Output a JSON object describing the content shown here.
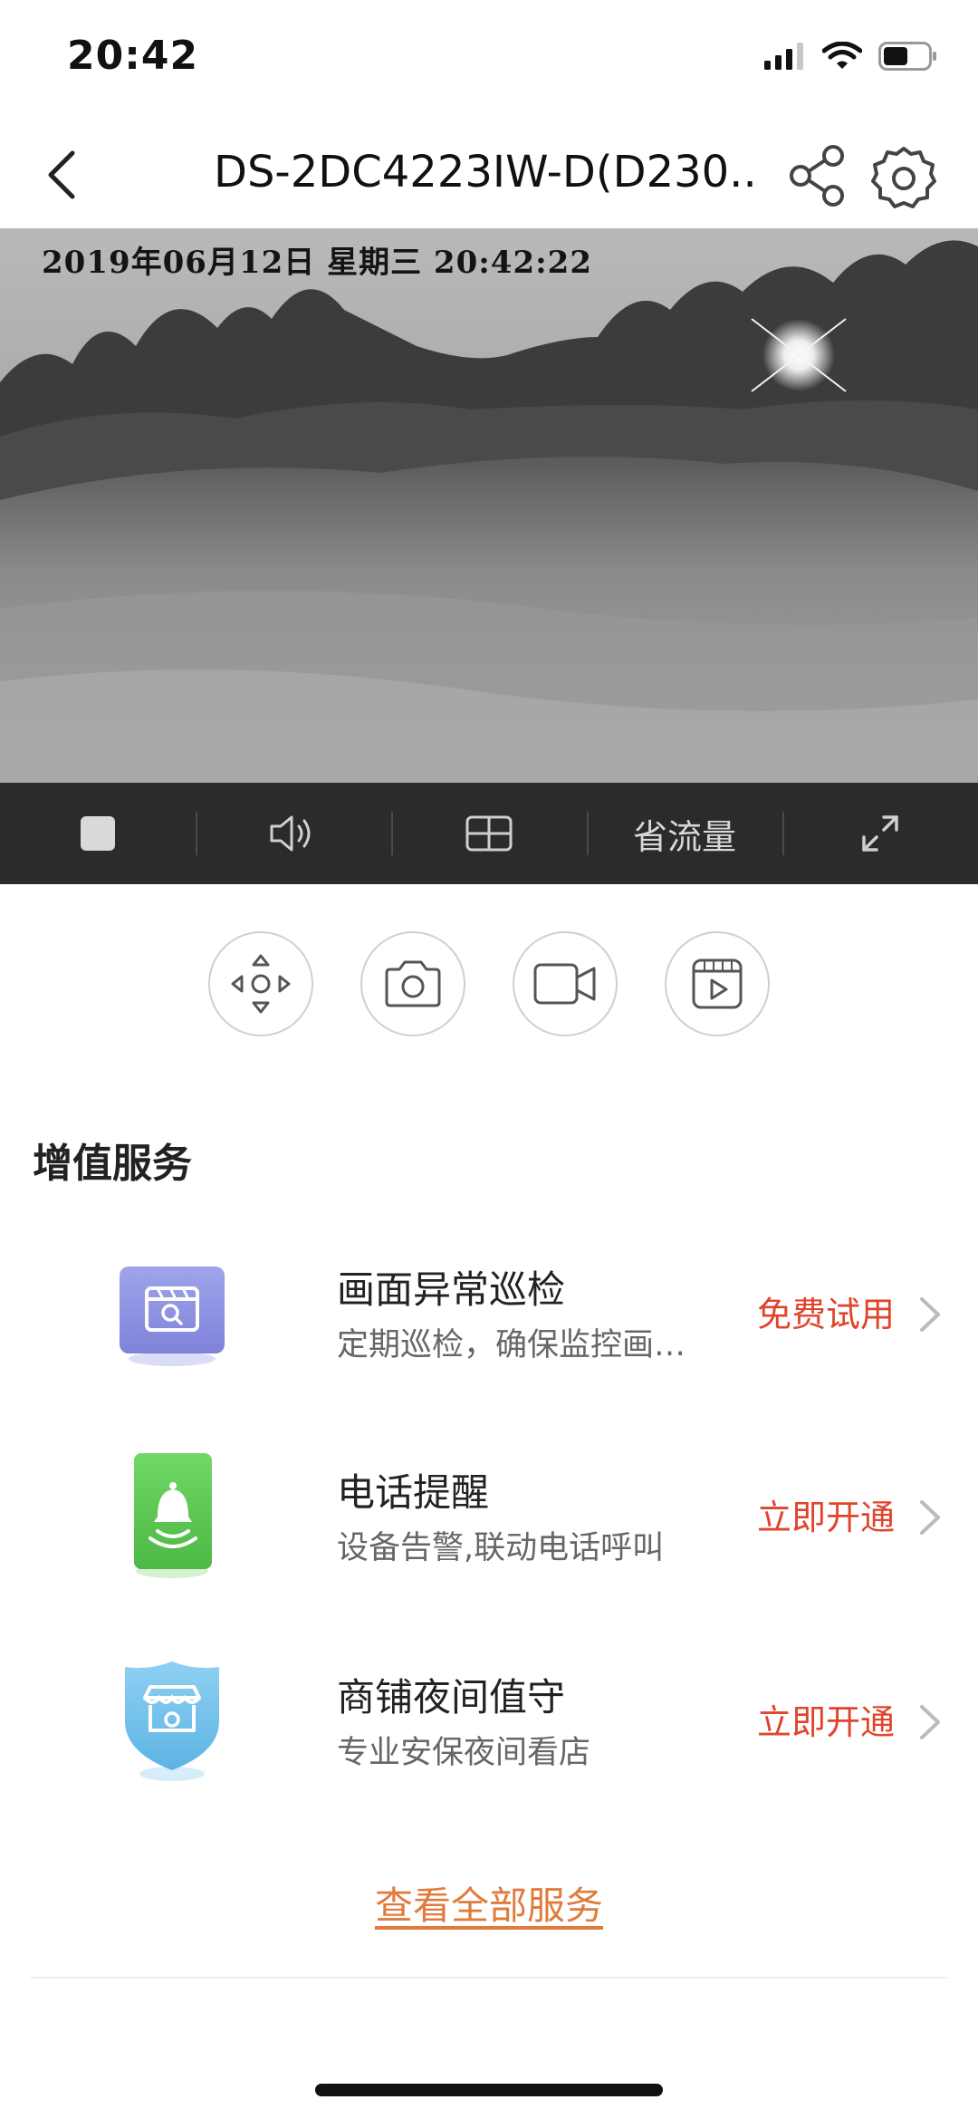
{
  "status_bar": {
    "time": "20:42",
    "icons": [
      "signal-icon",
      "wifi-icon",
      "battery-icon"
    ]
  },
  "nav": {
    "title": "DS-2DC4223IW-D(D230...",
    "icons": [
      "back-icon",
      "share-icon",
      "settings-icon"
    ]
  },
  "video": {
    "osd_text": "2019年06月12日  星期三  20:42:22"
  },
  "controls": {
    "stop_icon": "stop-icon",
    "sound_icon": "speaker-icon",
    "split_icon": "split-screen-icon",
    "traffic_label": "省流量",
    "fullscreen_icon": "fullscreen-icon"
  },
  "actions": [
    "ptz-direction-icon",
    "camera-icon",
    "video-record-icon",
    "playback-icon"
  ],
  "services": {
    "title": "增值服务",
    "items": [
      {
        "name": "画面异常巡检",
        "desc": "定期巡检，确保监控画…",
        "action": "免费试用",
        "icon": "inspection-icon"
      },
      {
        "name": "电话提醒",
        "desc": "设备告警,联动电话呼叫",
        "action": "立即开通",
        "icon": "bell-icon"
      },
      {
        "name": "商铺夜间值守",
        "desc": "专业安保夜间看店",
        "action": "立即开通",
        "icon": "shop-shield-icon"
      }
    ],
    "view_all": "查看全部服务"
  },
  "colors": {
    "accent_red": "#e0452c",
    "link_orange": "#e07b3c",
    "control_bar": "#2b2b2b"
  }
}
